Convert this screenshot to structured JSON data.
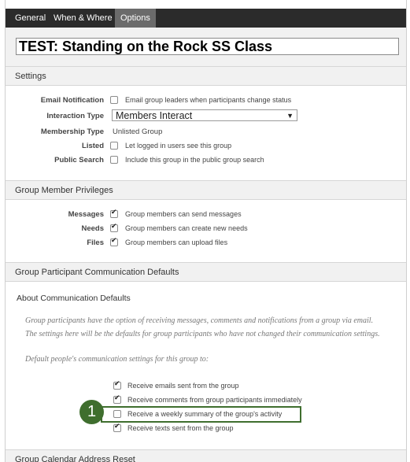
{
  "tabs": [
    {
      "label": "General"
    },
    {
      "label": "When & Where"
    },
    {
      "label": "Options"
    }
  ],
  "group_name": "TEST: Standing on the Rock SS Class",
  "settings": {
    "header": "Settings",
    "email_notification": {
      "label": "Email Notification",
      "text": "Email group leaders when participants change status",
      "checked": false
    },
    "interaction_type": {
      "label": "Interaction Type",
      "value": "Members Interact"
    },
    "membership_type": {
      "label": "Membership Type",
      "value": "Unlisted Group"
    },
    "listed": {
      "label": "Listed",
      "text": "Let logged in users see this group",
      "checked": false
    },
    "public_search": {
      "label": "Public Search",
      "text": "Include this group in the public group search",
      "checked": false
    }
  },
  "privileges": {
    "header": "Group Member Privileges",
    "items": [
      {
        "label": "Messages",
        "text": "Group members can send messages",
        "checked": true
      },
      {
        "label": "Needs",
        "text": "Group members can create new needs",
        "checked": true
      },
      {
        "label": "Files",
        "text": "Group members can upload files",
        "checked": true
      }
    ]
  },
  "communication": {
    "header": "Group Participant Communication Defaults",
    "subheader": "About Communication Defaults",
    "desc_line1": "Group participants have the option of receiving messages, comments and notifications from a group via email.",
    "desc_line2": "The settings here will be the defaults for group participants who have not changed their communication settings.",
    "desc_line3": "Default people's communication settings for this group to:",
    "options": [
      {
        "text": "Receive emails sent from the group",
        "checked": true
      },
      {
        "text": "Receive comments from group participants immediately",
        "checked": true
      },
      {
        "text": "Receive a weekly summary of the group's activity",
        "checked": false
      },
      {
        "text": "Receive texts sent from the group",
        "checked": true
      }
    ]
  },
  "callout_number": "1",
  "calendar_header": "Group Calendar Address Reset"
}
